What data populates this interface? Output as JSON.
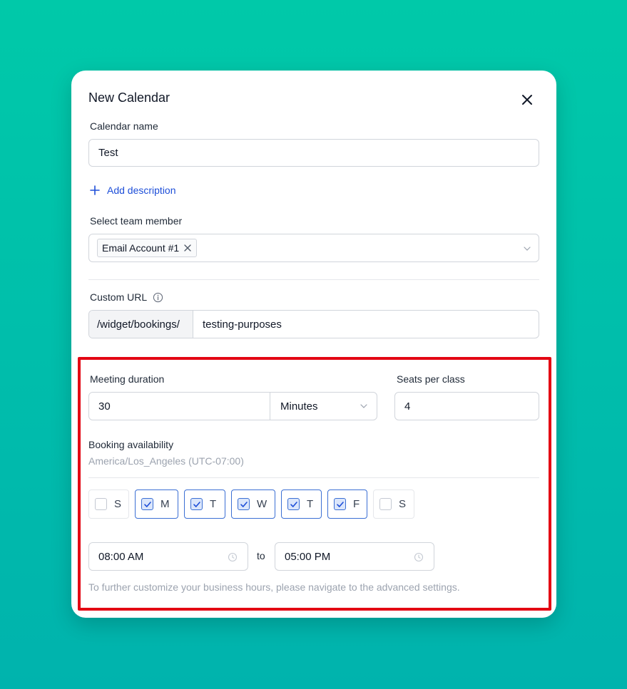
{
  "modal": {
    "title": "New Calendar"
  },
  "calendar_name": {
    "label": "Calendar name",
    "value": "Test"
  },
  "add_description": {
    "label": "Add description"
  },
  "team_member": {
    "label": "Select team member",
    "selected": "Email Account #1"
  },
  "custom_url": {
    "label": "Custom URL",
    "prefix": "/widget/bookings/",
    "value": "testing-purposes"
  },
  "meeting_duration": {
    "label": "Meeting duration",
    "value": "30",
    "unit": "Minutes"
  },
  "seats": {
    "label": "Seats per class",
    "value": "4"
  },
  "availability": {
    "label": "Booking availability",
    "timezone": "America/Los_Angeles (UTC-07:00)",
    "days": [
      {
        "letter": "S",
        "checked": false
      },
      {
        "letter": "M",
        "checked": true
      },
      {
        "letter": "T",
        "checked": true
      },
      {
        "letter": "W",
        "checked": true
      },
      {
        "letter": "T",
        "checked": true
      },
      {
        "letter": "F",
        "checked": true
      },
      {
        "letter": "S",
        "checked": false
      }
    ],
    "start_time": "08:00 AM",
    "to_label": "to",
    "end_time": "05:00 PM",
    "hint": "To further customize your business hours, please navigate to the advanced settings."
  },
  "colors": {
    "accent": "#1d4ed8",
    "highlight": "#e30613",
    "checkbox_border": "#3b6fd4"
  }
}
